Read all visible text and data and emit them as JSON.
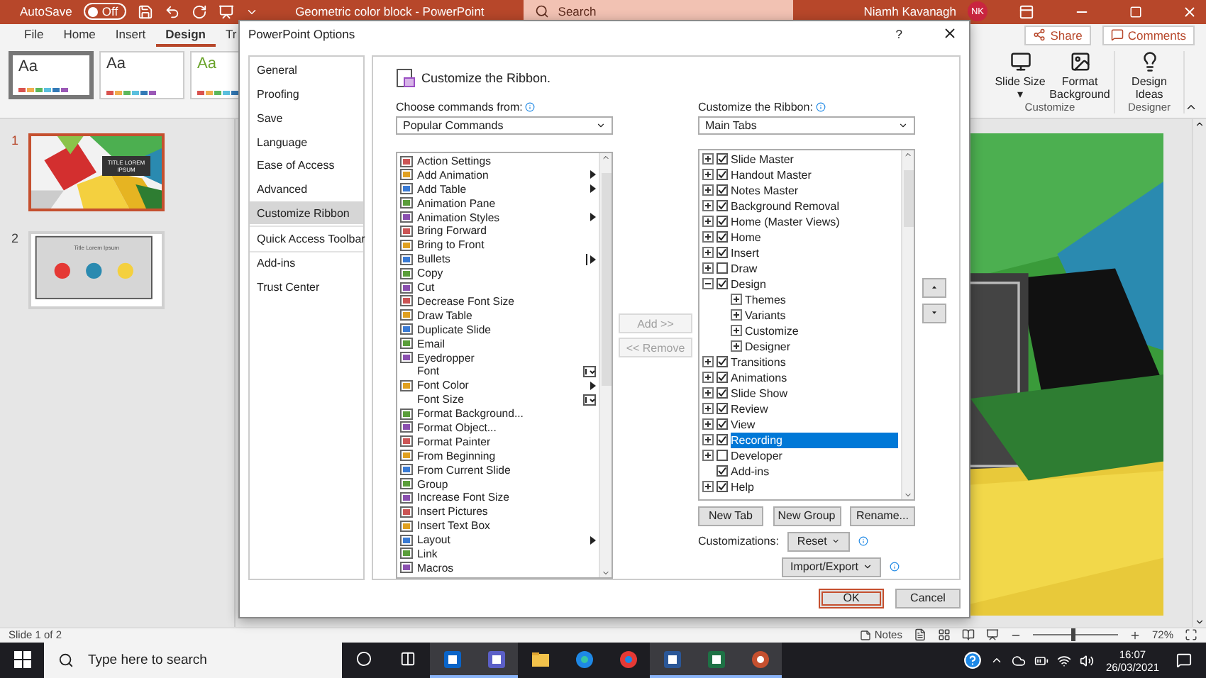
{
  "title_bar": {
    "autosave_label": "AutoSave",
    "autosave": {
      "on": false,
      "label": "Off"
    },
    "document_title": "Geometric color block  -  PowerPoint",
    "search_placeholder": "Search",
    "user_name": "Niamh Kavanagh",
    "user_initials": "NK"
  },
  "ribbon_tabs": [
    {
      "label": "File",
      "selected": false
    },
    {
      "label": "Home",
      "selected": false
    },
    {
      "label": "Insert",
      "selected": false
    },
    {
      "label": "Design",
      "selected": true
    },
    {
      "label": "Tr",
      "selected": false
    }
  ],
  "ribbon_actions": [
    "Share",
    "Comments"
  ],
  "themes": [
    {
      "label": "Aa",
      "selected": true,
      "kind": "dark"
    },
    {
      "label": "Aa",
      "selected": false,
      "kind": "light"
    },
    {
      "label": "Aa",
      "selected": false,
      "kind": "green"
    }
  ],
  "ribbon_groups": [
    {
      "label": "Customize",
      "buttons": [
        {
          "label": "Slide Size ▾",
          "kind": "size"
        },
        {
          "label": "Format Background",
          "kind": "background"
        }
      ]
    },
    {
      "label": "Designer",
      "buttons": [
        {
          "label": "Design Ideas",
          "kind": "ideas"
        }
      ]
    }
  ],
  "slides": [
    {
      "number": "1",
      "selected": true,
      "kind": "geometric",
      "title": "TITLE LOREM IPSUM"
    },
    {
      "number": "2",
      "selected": false,
      "kind": "icons",
      "title": "Title Lorem Ipsum"
    }
  ],
  "status_bar": {
    "slide_info": "Slide 1 of 2",
    "notes": "Notes",
    "zoom": {
      "level": 0.45,
      "reading": "72%"
    }
  },
  "taskbar": {
    "search_placeholder": "Type here to search",
    "time": "16:07",
    "date": "26/03/2021"
  },
  "dialog": {
    "title": "PowerPoint Options",
    "help": "?",
    "nav": [
      {
        "label": "General",
        "selected": false
      },
      {
        "label": "Proofing",
        "selected": false
      },
      {
        "label": "Save",
        "selected": false
      },
      {
        "label": "Language",
        "selected": false
      },
      {
        "label": "Ease of Access",
        "selected": false
      },
      {
        "label": "Advanced",
        "selected": false
      },
      {
        "label": "Customize Ribbon",
        "selected": true
      },
      {
        "label": "Quick Access Toolbar",
        "selected": false
      },
      {
        "label": "Add-ins",
        "selected": false
      },
      {
        "label": "Trust Center",
        "selected": false
      }
    ],
    "heading": "Customize the Ribbon.",
    "commands_label": "Choose commands from:",
    "commands_source": "Popular Commands",
    "commands": [
      {
        "label": "Action Settings",
        "kind": "plain",
        "icon": true
      },
      {
        "label": "Add Animation",
        "kind": "submenu",
        "icon": true
      },
      {
        "label": "Add Table",
        "kind": "submenu",
        "icon": true
      },
      {
        "label": "Animation Pane",
        "kind": "plain",
        "icon": true
      },
      {
        "label": "Animation Styles",
        "kind": "submenu",
        "icon": true
      },
      {
        "label": "Bring Forward",
        "kind": "plain",
        "icon": true
      },
      {
        "label": "Bring to Front",
        "kind": "plain",
        "icon": true
      },
      {
        "label": "Bullets",
        "kind": "split",
        "icon": true
      },
      {
        "label": "Copy",
        "kind": "plain",
        "icon": true
      },
      {
        "label": "Cut",
        "kind": "plain",
        "icon": true
      },
      {
        "label": "Decrease Font Size",
        "kind": "plain",
        "icon": true
      },
      {
        "label": "Draw Table",
        "kind": "plain",
        "icon": true
      },
      {
        "label": "Duplicate Slide",
        "kind": "plain",
        "icon": true
      },
      {
        "label": "Email",
        "kind": "plain",
        "icon": true
      },
      {
        "label": "Eyedropper",
        "kind": "plain",
        "icon": true
      },
      {
        "label": "Font",
        "kind": "picker",
        "icon": false
      },
      {
        "label": "Font Color",
        "kind": "submenu",
        "icon": true
      },
      {
        "label": "Font Size",
        "kind": "picker",
        "icon": false
      },
      {
        "label": "Format Background...",
        "kind": "plain",
        "icon": true
      },
      {
        "label": "Format Object...",
        "kind": "plain",
        "icon": true
      },
      {
        "label": "Format Painter",
        "kind": "plain",
        "icon": true
      },
      {
        "label": "From Beginning",
        "kind": "plain",
        "icon": true
      },
      {
        "label": "From Current Slide",
        "kind": "plain",
        "icon": true
      },
      {
        "label": "Group",
        "kind": "plain",
        "icon": true
      },
      {
        "label": "Increase Font Size",
        "kind": "plain",
        "icon": true
      },
      {
        "label": "Insert Pictures",
        "kind": "plain",
        "icon": true
      },
      {
        "label": "Insert Text Box",
        "kind": "plain",
        "icon": true
      },
      {
        "label": "Layout",
        "kind": "submenu",
        "icon": true
      },
      {
        "label": "Link",
        "kind": "plain",
        "icon": true
      },
      {
        "label": "Macros",
        "kind": "plain",
        "icon": true
      }
    ],
    "add_button": {
      "label": "Add >>",
      "disabled": true
    },
    "remove_button": {
      "label": "<< Remove",
      "disabled": true
    },
    "ribbon_label": "Customize the Ribbon:",
    "ribbon_source": "Main Tabs",
    "tabs_tree": [
      {
        "label": "Slide Master",
        "checked": true,
        "expandable": true,
        "expanded": false,
        "selected": false
      },
      {
        "label": "Handout Master",
        "checked": true,
        "expandable": true,
        "expanded": false,
        "selected": false
      },
      {
        "label": "Notes Master",
        "checked": true,
        "expandable": true,
        "expanded": false,
        "selected": false
      },
      {
        "label": "Background Removal",
        "checked": true,
        "expandable": true,
        "expanded": false,
        "selected": false
      },
      {
        "label": "Home (Master Views)",
        "checked": true,
        "expandable": true,
        "expanded": false,
        "selected": false
      },
      {
        "label": "Home",
        "checked": true,
        "expandable": true,
        "expanded": false,
        "selected": false
      },
      {
        "label": "Insert",
        "checked": true,
        "expandable": true,
        "expanded": false,
        "selected": false
      },
      {
        "label": "Draw",
        "checked": false,
        "expandable": true,
        "expanded": false,
        "selected": false
      },
      {
        "label": "Design",
        "checked": true,
        "expandable": true,
        "expanded": true,
        "selected": false,
        "children": [
          {
            "label": "Themes",
            "expanded": false
          },
          {
            "label": "Variants",
            "expanded": false
          },
          {
            "label": "Customize",
            "expanded": false
          },
          {
            "label": "Designer",
            "expanded": false
          }
        ]
      },
      {
        "label": "Transitions",
        "checked": true,
        "expandable": true,
        "expanded": false,
        "selected": false
      },
      {
        "label": "Animations",
        "checked": true,
        "expandable": true,
        "expanded": false,
        "selected": false
      },
      {
        "label": "Slide Show",
        "checked": true,
        "expandable": true,
        "expanded": false,
        "selected": false
      },
      {
        "label": "Review",
        "checked": true,
        "expandable": true,
        "expanded": false,
        "selected": false
      },
      {
        "label": "View",
        "checked": true,
        "expandable": true,
        "expanded": false,
        "selected": false
      },
      {
        "label": "Recording",
        "checked": true,
        "expandable": true,
        "expanded": false,
        "selected": true
      },
      {
        "label": "Developer",
        "checked": false,
        "expandable": true,
        "expanded": false,
        "selected": false
      },
      {
        "label": "Add-ins",
        "checked": true,
        "expandable": false,
        "expanded": false,
        "selected": false
      },
      {
        "label": "Help",
        "checked": true,
        "expandable": true,
        "expanded": false,
        "selected": false
      }
    ],
    "tree_buttons": [
      "New Tab",
      "New Group",
      "Rename..."
    ],
    "customizations_label": "Customizations:",
    "reset_label": "Reset",
    "import_export_label": "Import/Export",
    "ok": "OK",
    "cancel": "Cancel"
  }
}
